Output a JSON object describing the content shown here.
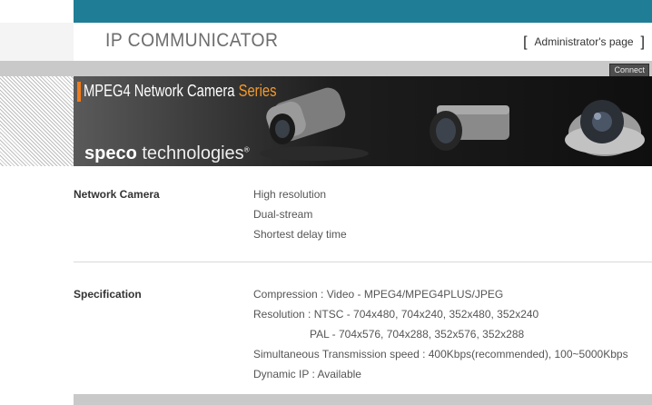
{
  "header": {
    "app_title": "IP COMMUNICATOR",
    "admin_bracket_left": "[",
    "admin_link": "Administrator's page",
    "admin_bracket_right": "]",
    "connect_label": "Connect"
  },
  "banner": {
    "title_main": "MPEG4 Network Camera",
    "title_series": "Series",
    "brand_bold": "speco",
    "brand_rest": " technologies",
    "brand_mark": "®"
  },
  "network_camera": {
    "label": "Network Camera",
    "items": [
      "High resolution",
      "Dual-stream",
      "Shortest delay time"
    ]
  },
  "specification": {
    "label": "Specification",
    "items": [
      "Compression : Video - MPEG4/MPEG4PLUS/JPEG",
      "Resolution : NTSC - 704x480, 704x240, 352x480, 352x240",
      "PAL - 704x576, 704x288, 352x576, 352x288",
      "Simultaneous Transmission speed : 400Kbps(recommended), 100~5000Kbps",
      "Dynamic IP : Available"
    ]
  },
  "colors": {
    "top_bar": "#1f7d96",
    "gray_band": "#c9c9c9",
    "banner_accent": "#f07b1c"
  }
}
